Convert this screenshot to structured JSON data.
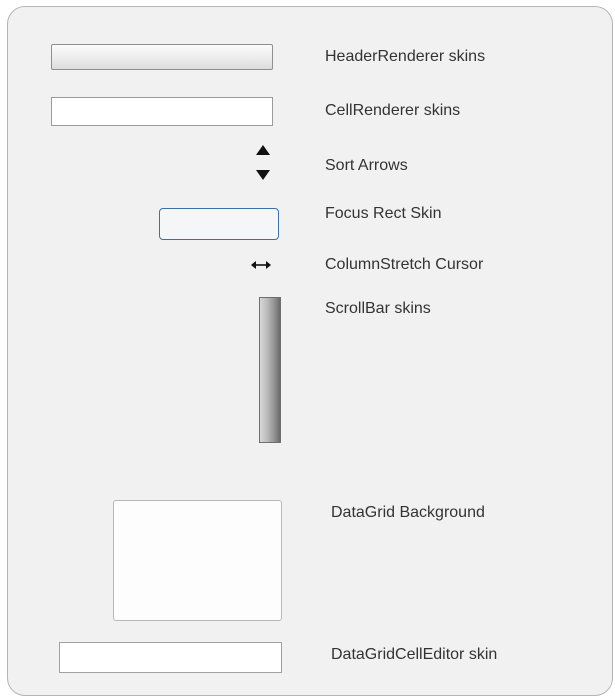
{
  "skins": {
    "header_renderer": {
      "label": "HeaderRenderer skins"
    },
    "cell_renderer": {
      "label": "CellRenderer skins"
    },
    "sort_arrows": {
      "label": "Sort Arrows",
      "icon": "sort-arrows-icon"
    },
    "focus_rect": {
      "label": "Focus Rect Skin",
      "border_color": "#3d6fa8"
    },
    "column_stretch_cursor": {
      "label": "ColumnStretch Cursor",
      "icon": "double-arrow-horizontal-icon"
    },
    "scrollbar": {
      "label": "ScrollBar skins"
    },
    "datagrid_background": {
      "label": "DataGrid Background"
    },
    "datagrid_cell_editor": {
      "label": "DataGridCellEditor skin"
    }
  },
  "colors": {
    "panel_background": "#f2f1f2",
    "panel_border": "#b5b5b5",
    "label_text": "#333333"
  }
}
